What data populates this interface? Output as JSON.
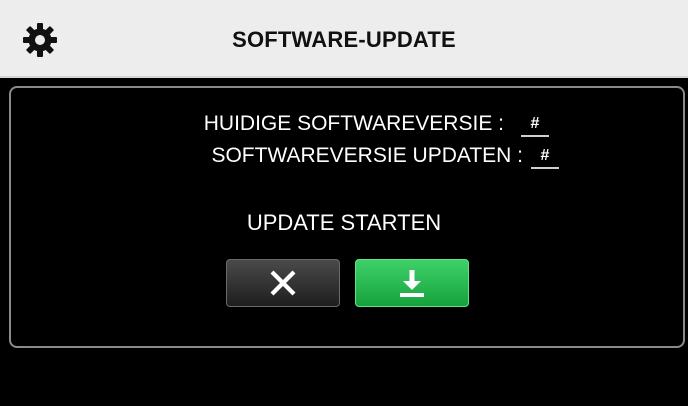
{
  "header": {
    "title": "SOFTWARE-UPDATE",
    "icon": "gear-icon"
  },
  "info": {
    "current_version_label": "HUIDIGE SOFTWAREVERSIE :",
    "current_version_value": "#",
    "update_version_label": "SOFTWAREVERSIE UPDATEN :",
    "update_version_value": "#"
  },
  "action": {
    "label": "UPDATE STARTEN",
    "cancel_icon": "close-icon",
    "confirm_icon": "download-icon"
  },
  "colors": {
    "header_bg": "#ededed",
    "background": "#000000",
    "cancel_button": "#2e2e2e",
    "update_button": "#22b24c",
    "panel_border": "#8a8a8a"
  }
}
